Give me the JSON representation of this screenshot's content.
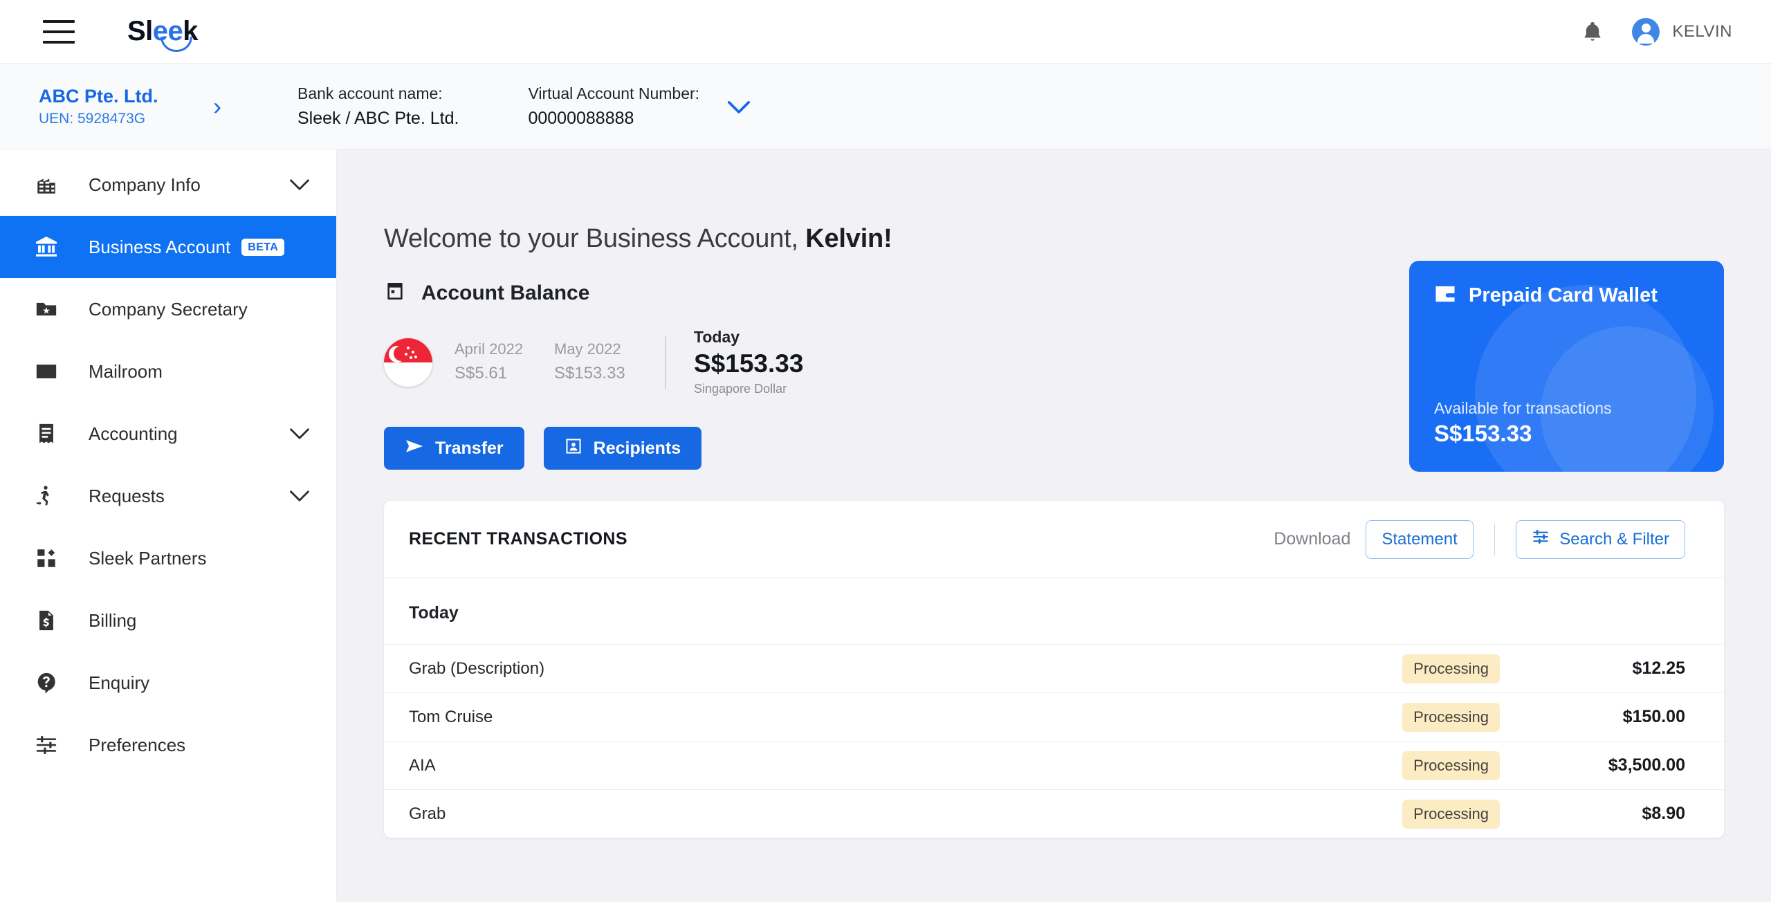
{
  "topbar": {
    "menu_icon": "hamburger-icon",
    "brand_part1": "Sl",
    "brand_part2": "ee",
    "brand_part3": "k",
    "notification_icon": "bell-icon",
    "user_name": "KELVIN"
  },
  "subheader": {
    "company_name": "ABC Pte. Ltd.",
    "company_uen": "UEN: 5928473G",
    "bank_account_label": "Bank account name:",
    "bank_account_value": "Sleek / ABC Pte. Ltd.",
    "virtual_account_label": "Virtual Account Number:",
    "virtual_account_value": "00000088888"
  },
  "sidebar": {
    "items": [
      {
        "label": "Company Info",
        "icon": "building-icon",
        "chevron": true,
        "active": false,
        "badge": ""
      },
      {
        "label": "Business Account",
        "icon": "bank-icon",
        "chevron": false,
        "active": true,
        "badge": "BETA"
      },
      {
        "label": "Company Secretary",
        "icon": "folder-star-icon",
        "chevron": false,
        "active": false,
        "badge": ""
      },
      {
        "label": "Mailroom",
        "icon": "envelope-icon",
        "chevron": false,
        "active": false,
        "badge": ""
      },
      {
        "label": "Accounting",
        "icon": "receipt-icon",
        "chevron": true,
        "active": false,
        "badge": ""
      },
      {
        "label": "Requests",
        "icon": "person-walk-icon",
        "chevron": true,
        "active": false,
        "badge": ""
      },
      {
        "label": "Sleek Partners",
        "icon": "blocks-icon",
        "chevron": false,
        "active": false,
        "badge": ""
      },
      {
        "label": "Billing",
        "icon": "invoice-icon",
        "chevron": false,
        "active": false,
        "badge": ""
      },
      {
        "label": "Enquiry",
        "icon": "help-icon",
        "chevron": false,
        "active": false,
        "badge": ""
      },
      {
        "label": "Preferences",
        "icon": "sliders-icon",
        "chevron": false,
        "active": false,
        "badge": ""
      }
    ]
  },
  "main": {
    "welcome_prefix": "Welcome to your Business Account, ",
    "welcome_name": "Kelvin!",
    "account_balance_title": "Account Balance",
    "account_balance_icon": "calendar-icon",
    "flag": "singapore-flag",
    "months": [
      {
        "label": "April 2022",
        "amount": "S$5.61"
      },
      {
        "label": "May 2022",
        "amount": "S$153.33"
      }
    ],
    "today_label": "Today",
    "today_amount": "S$153.33",
    "currency_name": "Singapore Dollar",
    "transfer_button": "Transfer",
    "recipients_button": "Recipients"
  },
  "prepaid_card": {
    "icon": "wallet-icon",
    "title": "Prepaid Card Wallet",
    "subtitle": "Available for transactions",
    "amount": "S$153.33"
  },
  "transactions": {
    "title": "RECENT TRANSACTIONS",
    "download_label": "Download",
    "statement_button": "Statement",
    "search_filter_button": "Search & Filter",
    "search_filter_icon": "sliders-icon",
    "group_label": "Today",
    "rows": [
      {
        "description": "Grab (Description)",
        "status": "Processing",
        "amount": "$12.25"
      },
      {
        "description": "Tom Cruise",
        "status": "Processing",
        "amount": "$150.00"
      },
      {
        "description": "AIA",
        "status": "Processing",
        "amount": "$3,500.00"
      },
      {
        "description": "Grab",
        "status": "Processing",
        "amount": "$8.90"
      }
    ]
  },
  "colors": {
    "brand_blue": "#1668e3",
    "active_nav": "#0f72f2",
    "card_blue": "#1a6ef5",
    "badge_bg": "#fbecc4",
    "page_bg": "#f2f2f6"
  }
}
